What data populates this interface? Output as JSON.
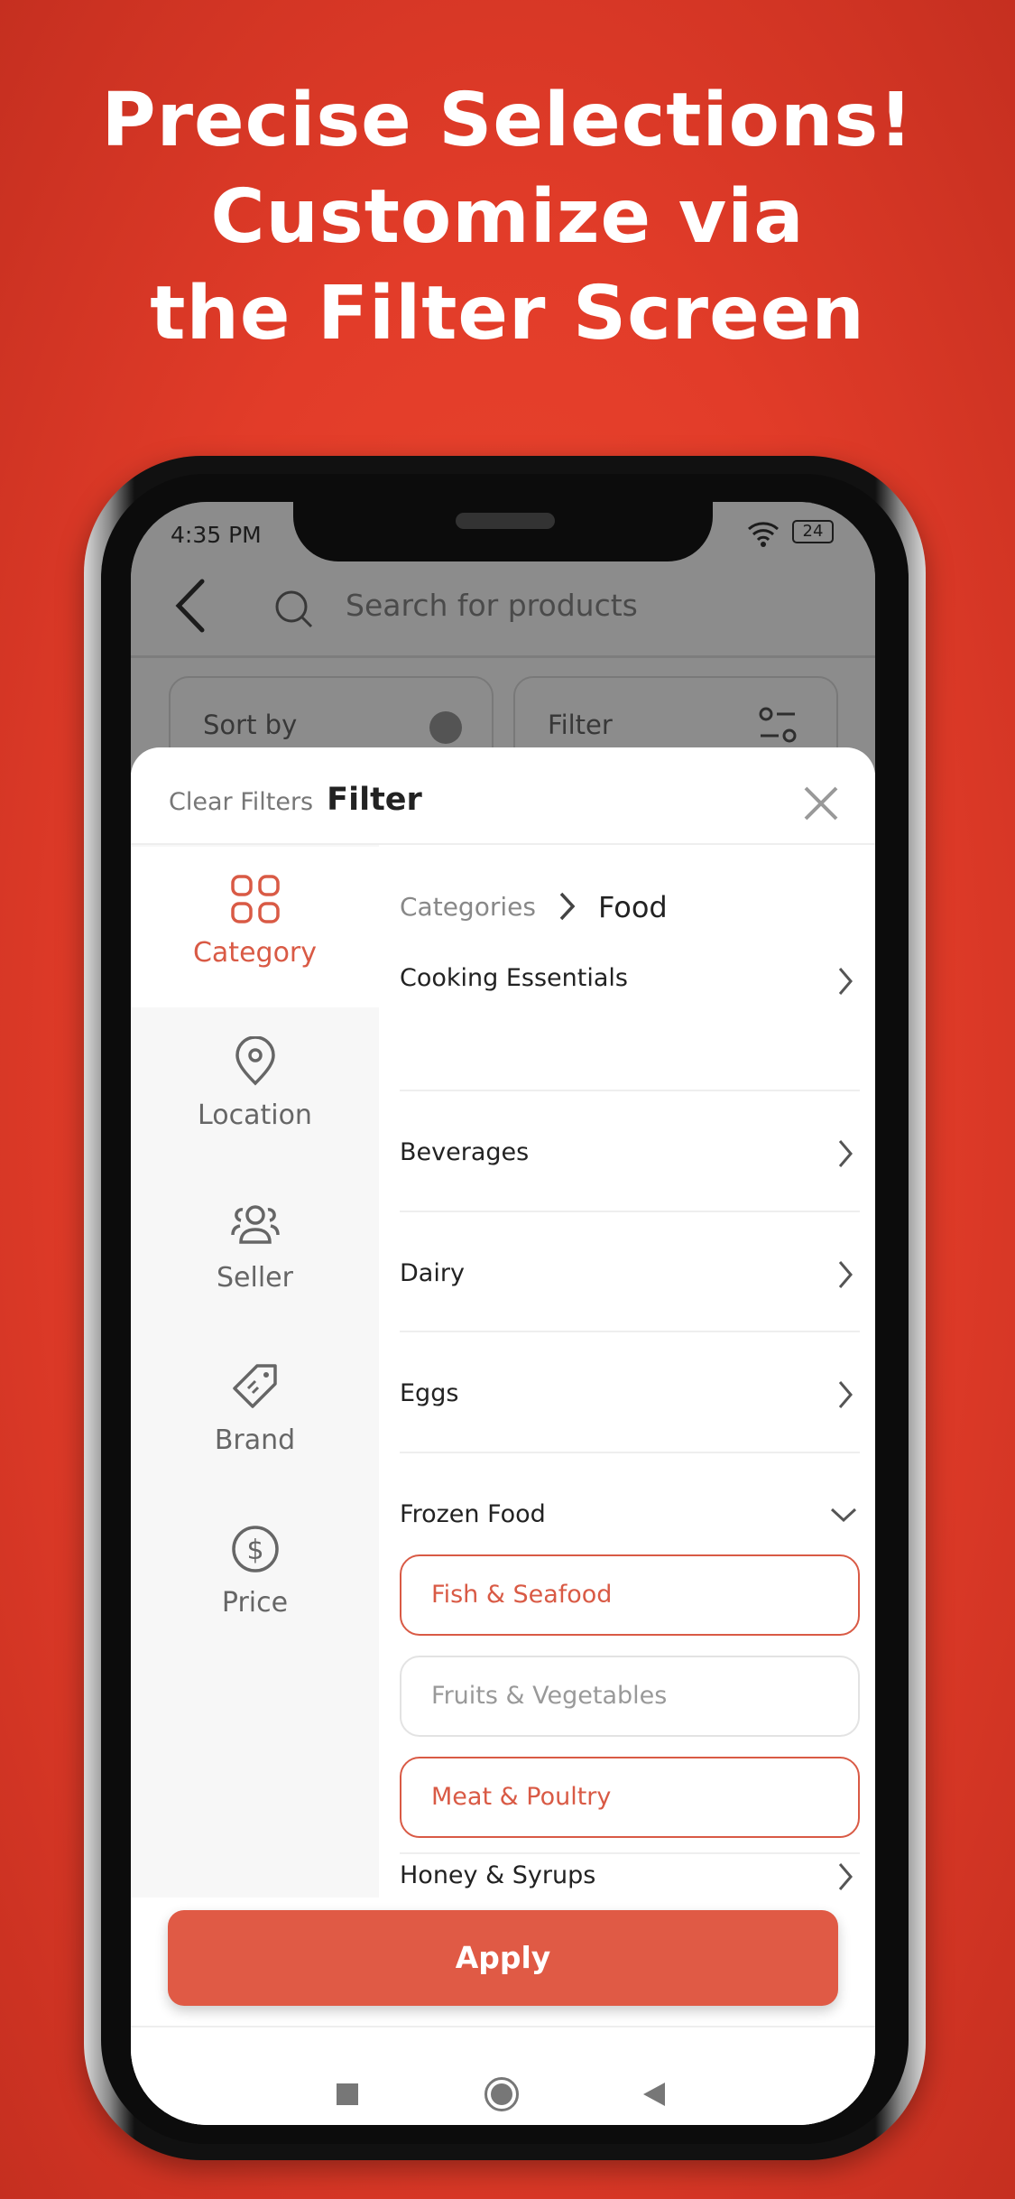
{
  "headline": [
    "Precise Selections!",
    "Customize via",
    "the Filter Screen"
  ],
  "status": {
    "time": "4:35 PM",
    "battery": "24"
  },
  "search": {
    "placeholder": "Search for products"
  },
  "toolbar": {
    "sort_label": "Sort by",
    "filter_label": "Filter"
  },
  "sheet": {
    "clear_label": "Clear Filters",
    "title": "Filter"
  },
  "sidebar": {
    "items": [
      {
        "label": "Category",
        "icon": "grid-icon",
        "active": true
      },
      {
        "label": "Location",
        "icon": "location-pin-icon"
      },
      {
        "label": "Seller",
        "icon": "users-icon"
      },
      {
        "label": "Brand",
        "icon": "tag-icon"
      },
      {
        "label": "Price",
        "icon": "dollar-icon"
      }
    ]
  },
  "breadcrumb": {
    "root": "Categories",
    "current": "Food"
  },
  "categories": [
    "Cooking Essentials",
    "Beverages",
    "Dairy",
    "Eggs",
    "Frozen Food",
    "Honey & Syrups"
  ],
  "subcategories": [
    {
      "label": "Fish & Seafood",
      "selected": true
    },
    {
      "label": "Fruits & Vegetables",
      "selected": false
    },
    {
      "label": "Meat & Poultry",
      "selected": true
    }
  ],
  "apply_label": "Apply",
  "colors": {
    "accent": "#d95a45",
    "background": "#e23c29"
  }
}
